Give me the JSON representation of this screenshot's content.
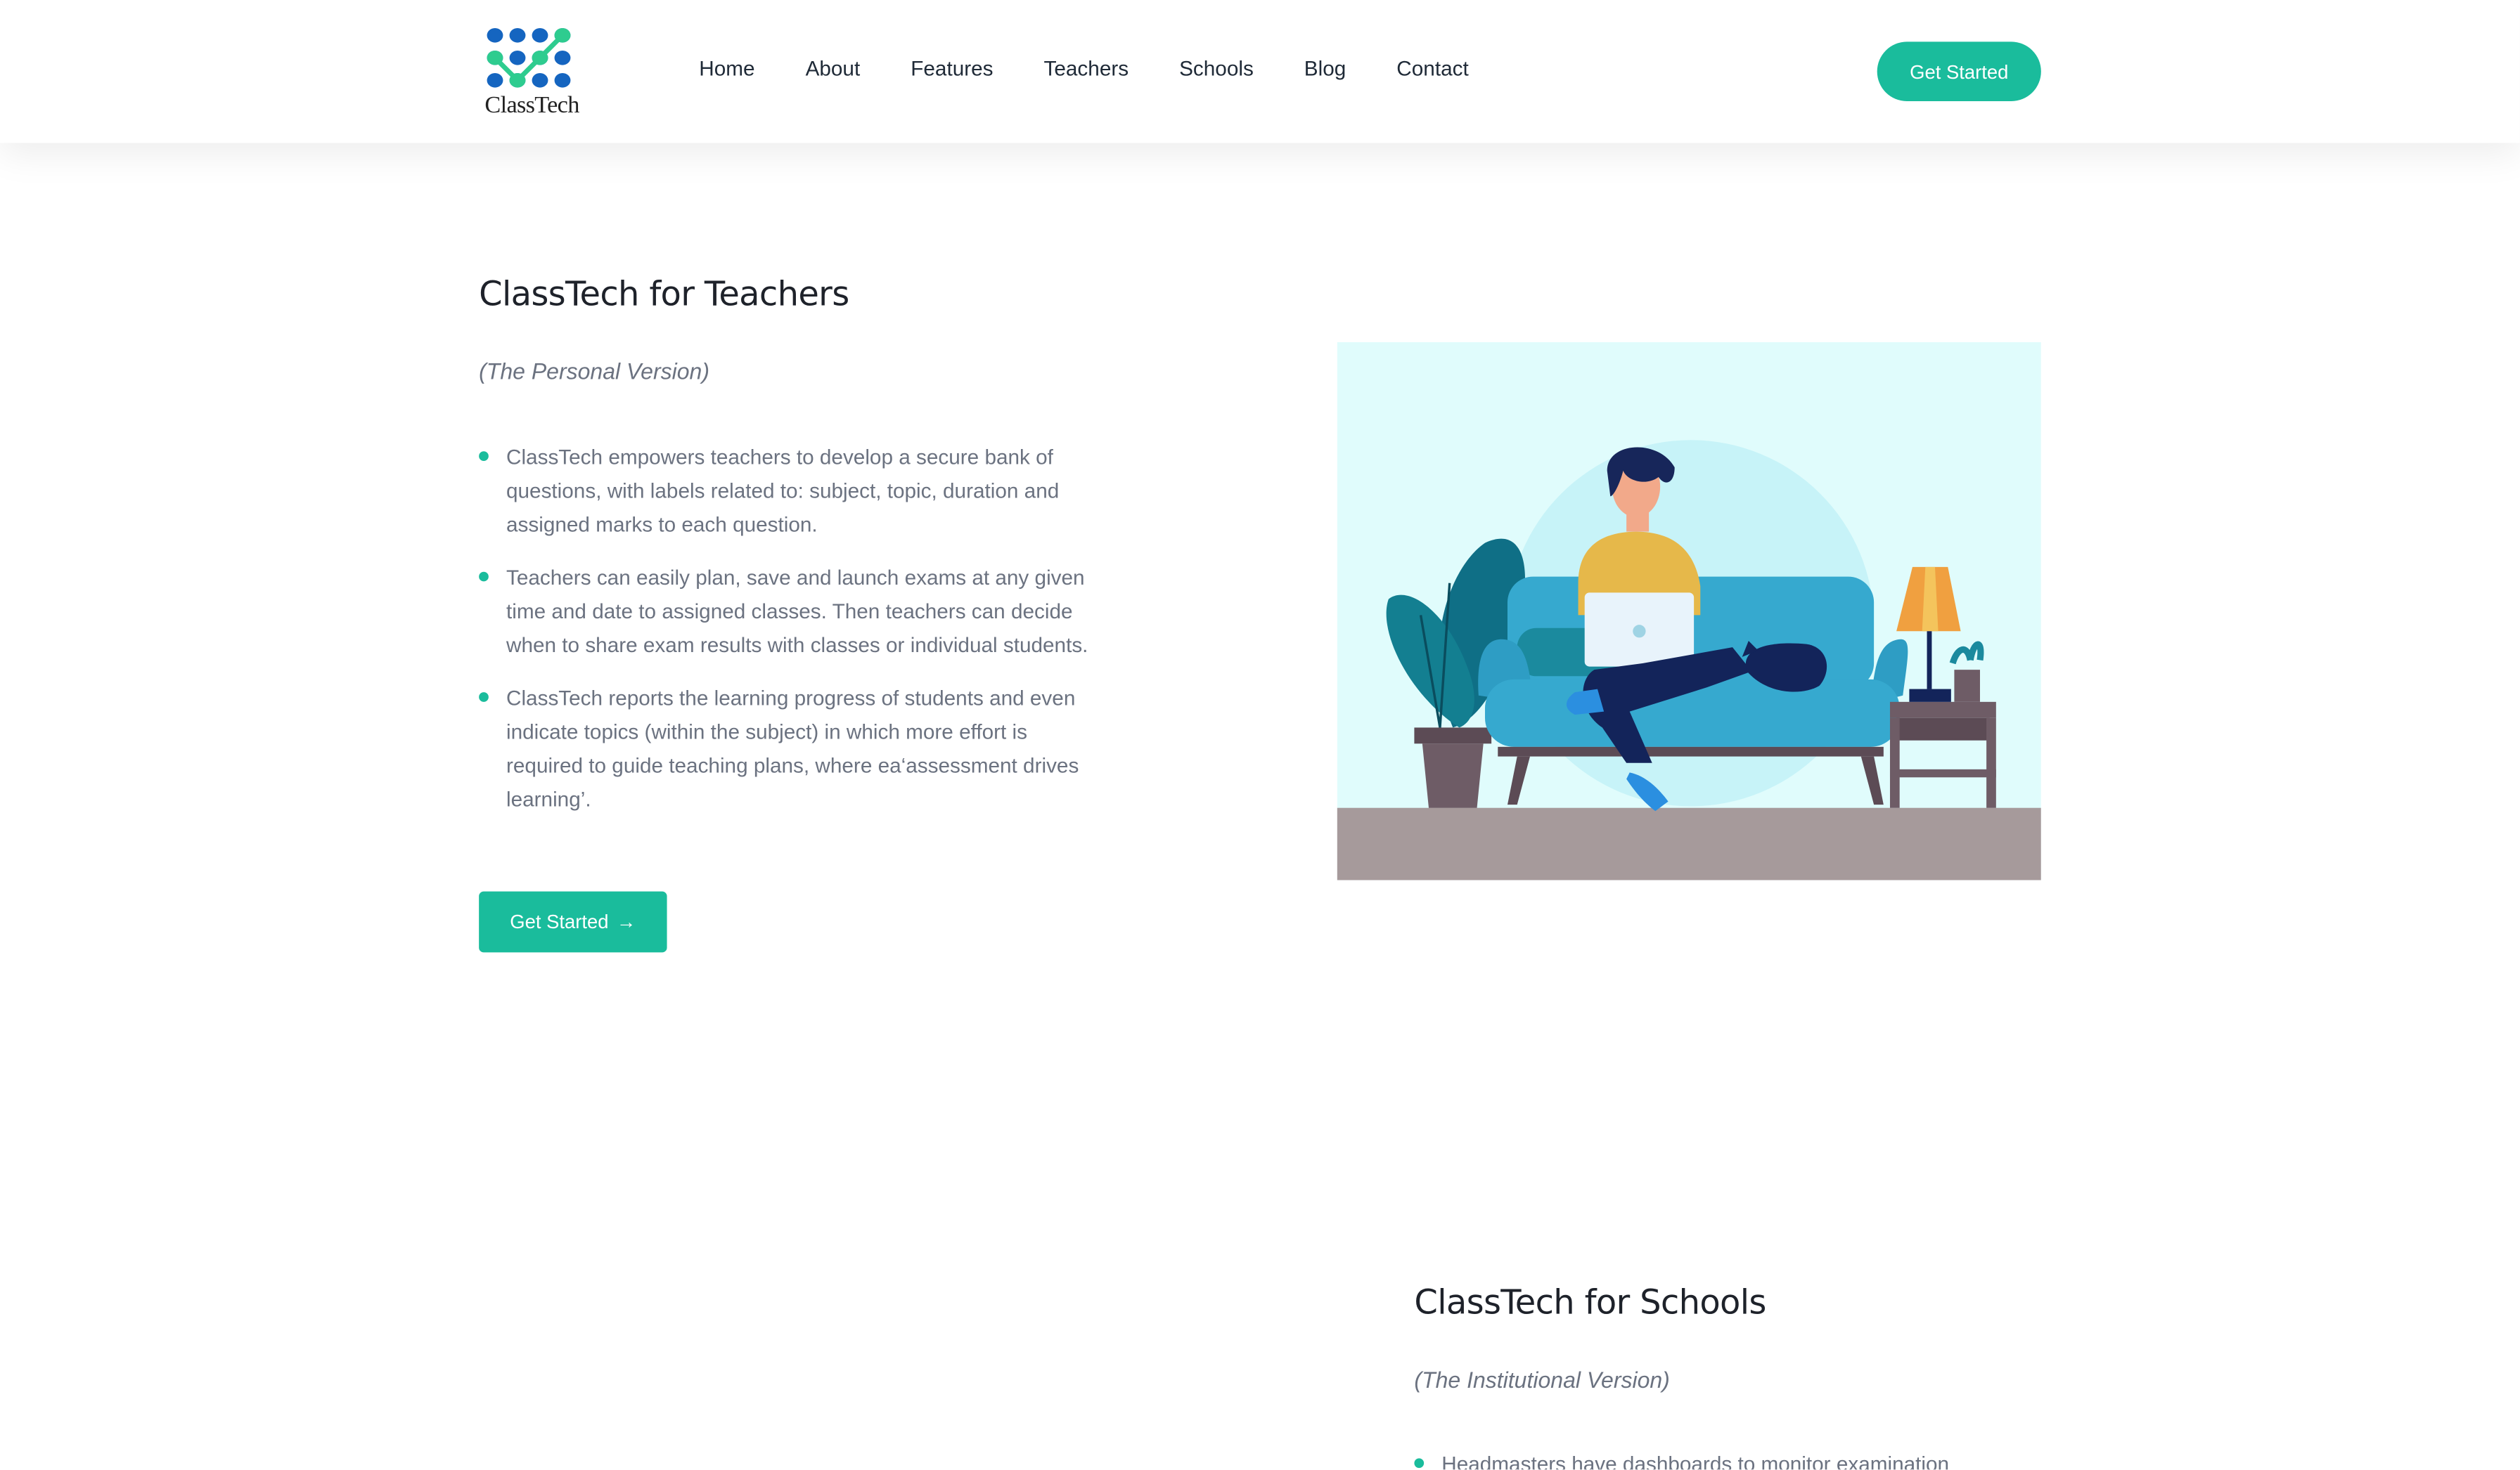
{
  "header": {
    "logo_text": "ClassTech",
    "nav": [
      "Home",
      "About",
      "Features",
      "Teachers",
      "Schools",
      "Blog",
      "Contact"
    ],
    "cta_label": "Get Started"
  },
  "teachers": {
    "title": "ClassTech for Teachers",
    "subtitle": "(The Personal Version)",
    "bullets": [
      "ClassTech empowers teachers to develop a secure bank of questions, with labels related to: subject, topic, duration and assigned marks to each question.",
      "Teachers can easily plan, save and launch exams at any given time and date to assigned classes. Then teachers can decide when to share exam results with classes or individual students.",
      "ClassTech reports the learning progress of students and even indicate topics (within the subject) in which more effort is required to guide teaching plans, where ea‘assessment drives learning’."
    ],
    "button_label": "Get Started",
    "button_icon": "arrow-right-icon"
  },
  "schools": {
    "title": "ClassTech for Schools",
    "subtitle": "(The Institutional Version)",
    "bullets": [
      "Headmasters have dashboards to monitor examination"
    ]
  },
  "colors": {
    "accent": "#1abc9c",
    "logo_blue": "#1565c0",
    "logo_green": "#2ecc8f",
    "illustration_bg": "#e0fcfc",
    "floor": "#a69a9b"
  }
}
